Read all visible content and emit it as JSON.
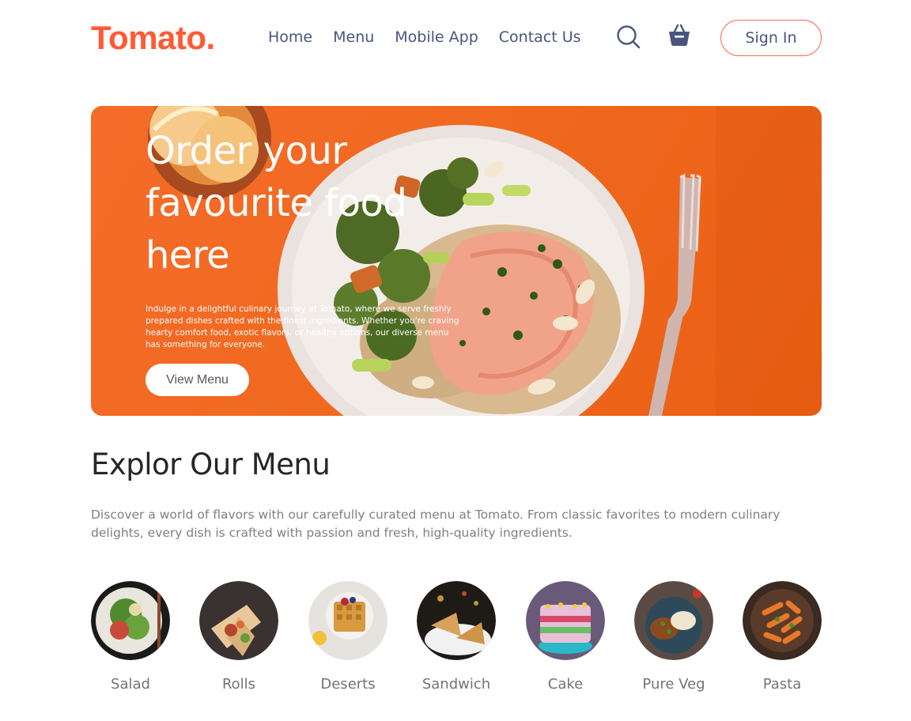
{
  "brand": {
    "logo": "Tomato.",
    "accent": "#ff6347"
  },
  "nav": {
    "links": [
      "Home",
      "Menu",
      "Mobile App",
      "Contact Us"
    ],
    "search_icon": "search-icon",
    "basket_icon": "basket-icon",
    "signin_label": "Sign In"
  },
  "hero": {
    "title": "Order your favourite food here",
    "description": "Indulge in a delightful culinary journey at Tomato, where we serve freshly prepared dishes crafted with the finest ingredients. Whether you're craving hearty comfort food, exotic flavors, or healthy options, our diverse menu has something for everyone.",
    "button_label": "View Menu"
  },
  "menu": {
    "title": "Explor Our Menu",
    "description": "Discover a world of flavors with our carefully curated menu at Tomato. From classic favorites to modern culinary delights, every dish is crafted with passion and fresh, high-quality ingredients.",
    "items": [
      {
        "label": "Salad"
      },
      {
        "label": "Rolls"
      },
      {
        "label": "Deserts"
      },
      {
        "label": "Sandwich"
      },
      {
        "label": "Cake"
      },
      {
        "label": "Pure Veg"
      },
      {
        "label": "Pasta"
      }
    ]
  }
}
